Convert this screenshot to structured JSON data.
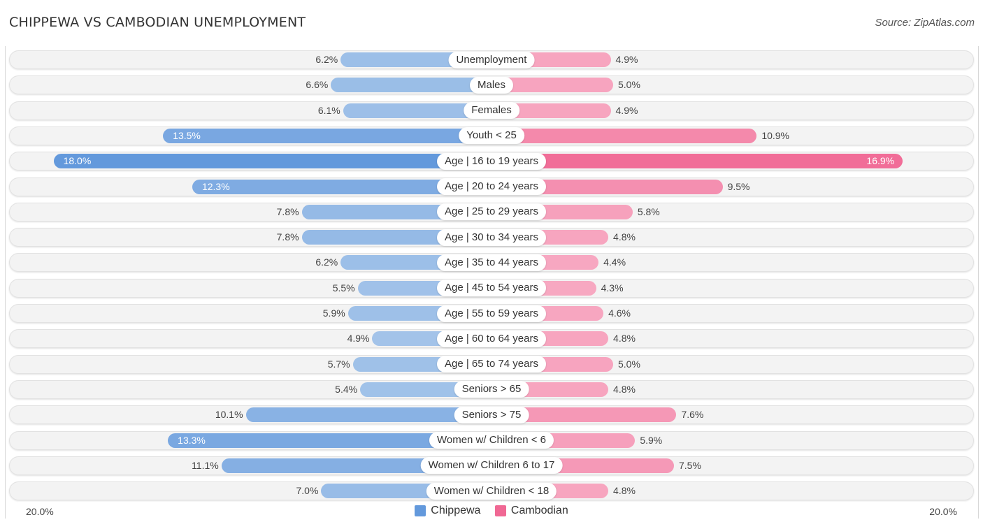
{
  "header": {
    "title": "CHIPPEWA VS CAMBODIAN UNEMPLOYMENT",
    "source": "Source: ZipAtlas.com"
  },
  "colors": {
    "chippewa_strong": "#6399dc",
    "chippewa_light": "#a7c6ea",
    "cambodian_strong": "#f06894",
    "cambodian_light": "#f7a9c2"
  },
  "chart_data": {
    "type": "bar",
    "orientation": "horizontal-diverging",
    "title": "CHIPPEWA VS CAMBODIAN UNEMPLOYMENT",
    "categories": [
      "Unemployment",
      "Males",
      "Females",
      "Youth < 25",
      "Age | 16 to 19 years",
      "Age | 20 to 24 years",
      "Age | 25 to 29 years",
      "Age | 30 to 34 years",
      "Age | 35 to 44 years",
      "Age | 45 to 54 years",
      "Age | 55 to 59 years",
      "Age | 60 to 64 years",
      "Age | 65 to 74 years",
      "Seniors > 65",
      "Seniors > 75",
      "Women w/ Children < 6",
      "Women w/ Children 6 to 17",
      "Women w/ Children < 18"
    ],
    "series": [
      {
        "name": "Chippewa",
        "side": "left",
        "values": [
          6.2,
          6.6,
          6.1,
          13.5,
          18.0,
          12.3,
          7.8,
          7.8,
          6.2,
          5.5,
          5.9,
          4.9,
          5.7,
          5.4,
          10.1,
          13.3,
          11.1,
          7.0
        ],
        "labels": [
          "6.2%",
          "6.6%",
          "6.1%",
          "13.5%",
          "18.0%",
          "12.3%",
          "7.8%",
          "7.8%",
          "6.2%",
          "5.5%",
          "5.9%",
          "4.9%",
          "5.7%",
          "5.4%",
          "10.1%",
          "13.3%",
          "11.1%",
          "7.0%"
        ]
      },
      {
        "name": "Cambodian",
        "side": "right",
        "values": [
          4.9,
          5.0,
          4.9,
          10.9,
          16.9,
          9.5,
          5.8,
          4.8,
          4.4,
          4.3,
          4.6,
          4.8,
          5.0,
          4.8,
          7.6,
          5.9,
          7.5,
          4.8
        ],
        "labels": [
          "4.9%",
          "5.0%",
          "4.9%",
          "10.9%",
          "16.9%",
          "9.5%",
          "5.8%",
          "4.8%",
          "4.4%",
          "4.3%",
          "4.6%",
          "4.8%",
          "5.0%",
          "4.8%",
          "7.6%",
          "5.9%",
          "7.5%",
          "4.8%"
        ]
      }
    ],
    "xlim": [
      -20,
      20
    ],
    "axis_labels": {
      "left": "20.0%",
      "right": "20.0%"
    },
    "unit": "%",
    "legend": {
      "position": "bottom-center",
      "items": [
        "Chippewa",
        "Cambodian"
      ]
    }
  }
}
